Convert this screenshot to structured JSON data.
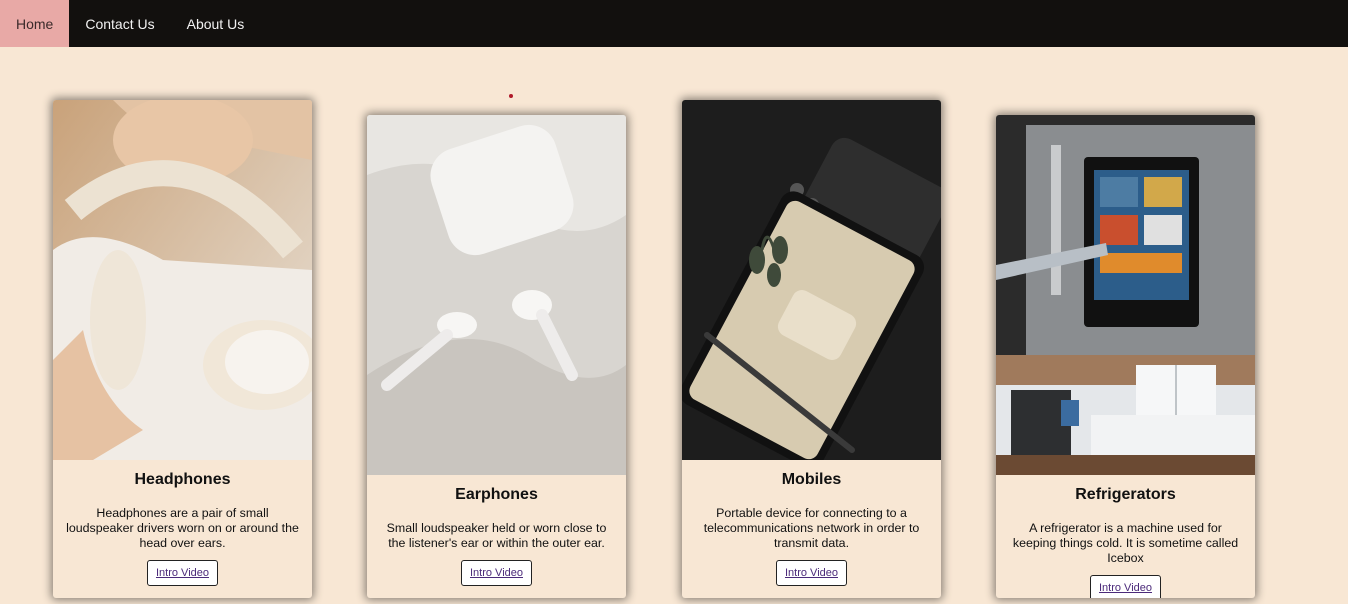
{
  "nav": {
    "items": [
      {
        "label": "Home",
        "active": true
      },
      {
        "label": "Contact Us",
        "active": false
      },
      {
        "label": "About Us",
        "active": false
      }
    ]
  },
  "cards": [
    {
      "title": "Headphones",
      "description": "Headphones are a pair of small loudspeaker drivers worn on or around the head over ears.",
      "button_label": "Intro Video",
      "image_icon": "headphones-photo"
    },
    {
      "title": "Earphones",
      "description": "Small loudspeaker held or worn close to the listener's ear or within the outer ear.",
      "button_label": "Intro Video",
      "image_icon": "earphones-photo"
    },
    {
      "title": "Mobiles",
      "description": "Portable device for connecting to a telecommunications network in order to transmit data.",
      "button_label": "Intro Video",
      "image_icon": "mobile-photo"
    },
    {
      "title": "Refrigerators",
      "description": "A refrigerator is a machine used for keeping things cold. It is sometime called Icebox",
      "button_label": "Intro Video",
      "image_icon": "refrigerator-photo"
    }
  ],
  "colors": {
    "background": "#f8e7d4",
    "navbar": "#12100e",
    "nav_active": "#e8a9a6",
    "link": "#4b2a7a"
  }
}
